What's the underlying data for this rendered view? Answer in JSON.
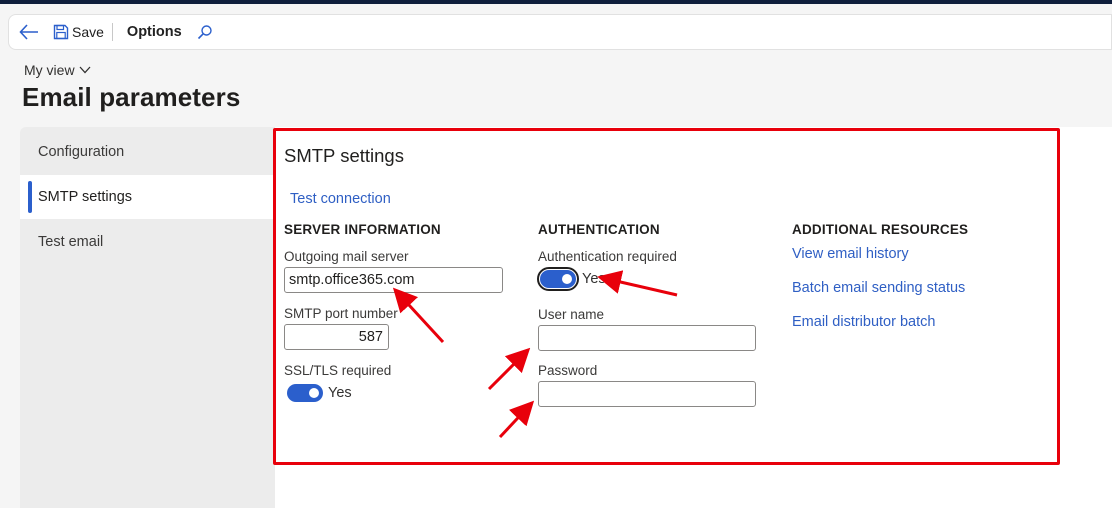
{
  "toolbar": {
    "save_label": "Save",
    "options_label": "Options"
  },
  "view": {
    "label": "My view"
  },
  "page": {
    "title": "Email parameters"
  },
  "nav": {
    "items": [
      {
        "label": "Configuration",
        "selected": false
      },
      {
        "label": "SMTP settings",
        "selected": true
      },
      {
        "label": "Test email",
        "selected": false
      }
    ]
  },
  "smtp": {
    "title": "SMTP settings",
    "test_connection": "Test connection",
    "server": {
      "heading": "SERVER INFORMATION",
      "outgoing_label": "Outgoing mail server",
      "outgoing_value": "smtp.office365.com",
      "port_label": "SMTP port number",
      "port_value": "587",
      "ssl_label": "SSL/TLS required",
      "ssl_value": "Yes"
    },
    "auth": {
      "heading": "AUTHENTICATION",
      "required_label": "Authentication required",
      "required_value": "Yes",
      "username_label": "User name",
      "username_value": "",
      "password_label": "Password",
      "password_value": ""
    },
    "resources": {
      "heading": "ADDITIONAL RESOURCES",
      "links": [
        "View email history",
        "Batch email sending status",
        "Email distributor batch"
      ]
    }
  },
  "colors": {
    "accent": "#2b5fcc",
    "link": "#2f5fc4",
    "annotation": "#e8000b",
    "top_band": "#0f1e3c"
  },
  "icons": [
    "back-arrow-icon",
    "save-icon",
    "search-icon",
    "chevron-down-icon"
  ]
}
